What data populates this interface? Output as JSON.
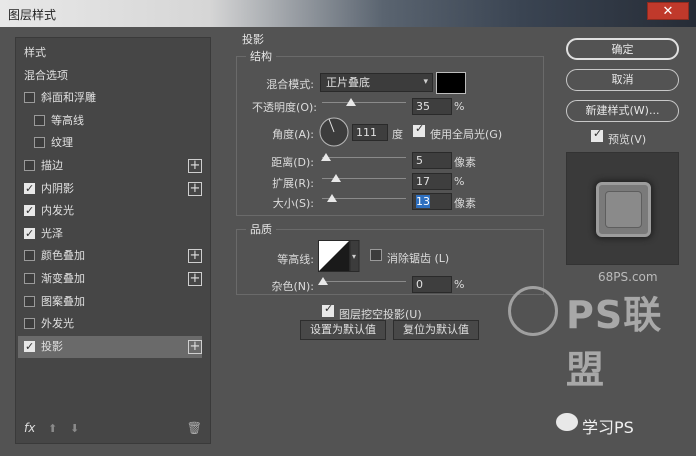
{
  "window": {
    "title": "图层样式",
    "close": "✕"
  },
  "left": {
    "items": [
      {
        "label": "样式",
        "checkbox": false,
        "checked": false,
        "indent": 0,
        "plus": false
      },
      {
        "label": "混合选项",
        "checkbox": false,
        "checked": false,
        "indent": 0,
        "plus": false
      },
      {
        "label": "斜面和浮雕",
        "checkbox": true,
        "checked": false,
        "indent": 0,
        "plus": false
      },
      {
        "label": "等高线",
        "checkbox": true,
        "checked": false,
        "indent": 1,
        "plus": false
      },
      {
        "label": "纹理",
        "checkbox": true,
        "checked": false,
        "indent": 1,
        "plus": false
      },
      {
        "label": "描边",
        "checkbox": true,
        "checked": false,
        "indent": 0,
        "plus": true
      },
      {
        "label": "内阴影",
        "checkbox": true,
        "checked": true,
        "indent": 0,
        "plus": true
      },
      {
        "label": "内发光",
        "checkbox": true,
        "checked": true,
        "indent": 0,
        "plus": false
      },
      {
        "label": "光泽",
        "checkbox": true,
        "checked": true,
        "indent": 0,
        "plus": false
      },
      {
        "label": "颜色叠加",
        "checkbox": true,
        "checked": false,
        "indent": 0,
        "plus": true
      },
      {
        "label": "渐变叠加",
        "checkbox": true,
        "checked": false,
        "indent": 0,
        "plus": true
      },
      {
        "label": "图案叠加",
        "checkbox": true,
        "checked": false,
        "indent": 0,
        "plus": false
      },
      {
        "label": "外发光",
        "checkbox": true,
        "checked": false,
        "indent": 0,
        "plus": false
      },
      {
        "label": "投影",
        "checkbox": true,
        "checked": true,
        "indent": 0,
        "plus": true,
        "active": true
      }
    ],
    "footer": {
      "fx": "fx",
      "up": "⬆",
      "down": "⬇",
      "trash": "🗑"
    }
  },
  "shadow": {
    "section_title": "投影",
    "structure": {
      "title": "结构",
      "blend_label": "混合模式:",
      "blend_value": "正片叠底",
      "opacity_label": "不透明度(O):",
      "opacity_value": "35",
      "opacity_unit": "%",
      "opacity_level": 0.35,
      "angle_label": "角度(A):",
      "angle_value": "111",
      "angle_unit": "度",
      "global_light_label": "使用全局光(G)",
      "global_light_checked": true,
      "distance_label": "距离(D):",
      "distance_value": "5",
      "distance_unit": "像素",
      "spread_label": "扩展(R):",
      "spread_value": "17",
      "spread_unit": "%",
      "size_label": "大小(S):",
      "size_value": "13",
      "size_unit": "像素"
    },
    "quality": {
      "title": "品质",
      "contour_label": "等高线:",
      "antialias_label": "消除锯齿 (L)",
      "antialias_checked": false,
      "noise_label": "杂色(N):",
      "noise_value": "0",
      "noise_unit": "%"
    },
    "knockout_label": "图层挖空投影(U)",
    "knockout_checked": true,
    "make_default": "设置为默认值",
    "reset_default": "复位为默认值"
  },
  "right": {
    "ok": "确定",
    "cancel": "取消",
    "new_style": "新建样式(W)...",
    "preview_label": "预览(V)",
    "preview_checked": true
  },
  "watermark": {
    "site": "68PS.com",
    "logo": "PS联盟",
    "bottom": "学习PS"
  },
  "colors": {
    "shadow_color": "#000000",
    "active_item": "#6a6a6a"
  }
}
